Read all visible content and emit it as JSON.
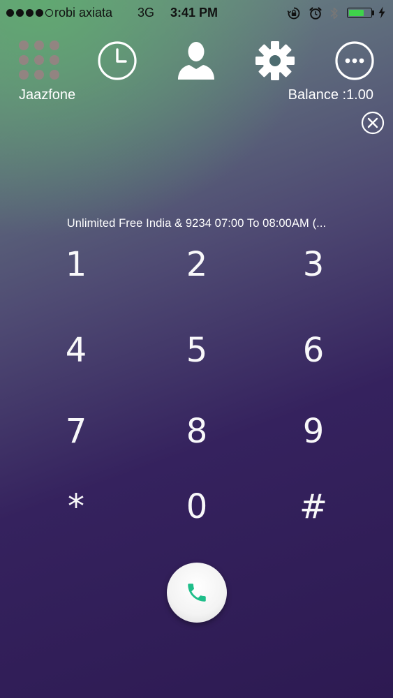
{
  "status_bar": {
    "carrier": "robi axiata",
    "network": "3G",
    "time": "3:41 PM",
    "signal_bars_filled": 4,
    "signal_bars_total": 5,
    "battery_level": 0.7,
    "battery_color": "#3fd34b",
    "icons": [
      "rotation-lock-icon",
      "alarm-icon",
      "bluetooth-icon",
      "battery-icon",
      "charging-icon"
    ]
  },
  "nav": {
    "app_name": "Jaazfone",
    "balance": "Balance :1.00",
    "items": [
      "apps-grid-icon",
      "history-clock-icon",
      "contacts-person-icon",
      "settings-gear-icon",
      "more-options-icon"
    ]
  },
  "promo_text": "Unlimited Free India & 9234 07:00 To 08:00AM (...",
  "keypad": {
    "keys": [
      "1",
      "2",
      "3",
      "4",
      "5",
      "6",
      "7",
      "8",
      "9",
      "*",
      "0",
      "#"
    ]
  },
  "call_button": {
    "icon": "phone-icon",
    "accent": "#1fbe8a"
  },
  "colors": {
    "bg_top": "#60aa70",
    "bg_bottom": "#2d1a52",
    "text": "#ffffff"
  }
}
